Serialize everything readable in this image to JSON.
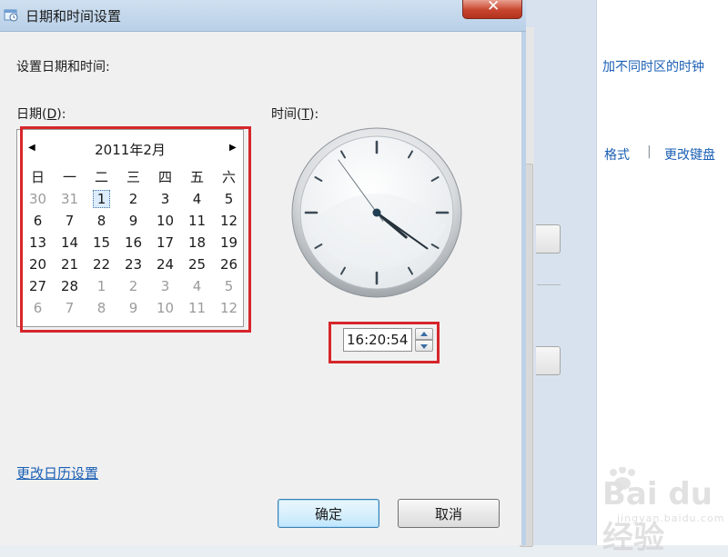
{
  "background": {
    "link_timezone_clocks": "加不同时区的时钟",
    "link_format": "格式",
    "separator": "|",
    "link_keyboard": "更改键盘"
  },
  "dialog": {
    "title": "日期和时间设置",
    "heading": "设置日期和时间:",
    "date_label_prefix": "日期(",
    "date_label_key": "D",
    "date_label_suffix": "):",
    "time_label_prefix": "时间(",
    "time_label_key": "T",
    "time_label_suffix": "):",
    "calendar": {
      "month_title": "2011年2月",
      "weekdays": [
        "日",
        "一",
        "二",
        "三",
        "四",
        "五",
        "六"
      ],
      "weeks": [
        [
          {
            "d": "30",
            "o": true
          },
          {
            "d": "31",
            "o": true
          },
          {
            "d": "1",
            "sel": true
          },
          {
            "d": "2"
          },
          {
            "d": "3"
          },
          {
            "d": "4"
          },
          {
            "d": "5"
          }
        ],
        [
          {
            "d": "6"
          },
          {
            "d": "7"
          },
          {
            "d": "8"
          },
          {
            "d": "9"
          },
          {
            "d": "10"
          },
          {
            "d": "11"
          },
          {
            "d": "12"
          }
        ],
        [
          {
            "d": "13"
          },
          {
            "d": "14"
          },
          {
            "d": "15"
          },
          {
            "d": "16"
          },
          {
            "d": "17"
          },
          {
            "d": "18"
          },
          {
            "d": "19"
          }
        ],
        [
          {
            "d": "20"
          },
          {
            "d": "21"
          },
          {
            "d": "22"
          },
          {
            "d": "23"
          },
          {
            "d": "24"
          },
          {
            "d": "25"
          },
          {
            "d": "26"
          }
        ],
        [
          {
            "d": "27"
          },
          {
            "d": "28"
          },
          {
            "d": "1",
            "o": true
          },
          {
            "d": "2",
            "o": true
          },
          {
            "d": "3",
            "o": true
          },
          {
            "d": "4",
            "o": true
          },
          {
            "d": "5",
            "o": true
          }
        ],
        [
          {
            "d": "6",
            "o": true
          },
          {
            "d": "7",
            "o": true
          },
          {
            "d": "8",
            "o": true
          },
          {
            "d": "9",
            "o": true
          },
          {
            "d": "10",
            "o": true
          },
          {
            "d": "11",
            "o": true
          },
          {
            "d": "12",
            "o": true
          }
        ]
      ]
    },
    "clock": {
      "hour": 16,
      "minute": 20,
      "second": 54
    },
    "time_value": "16:20:54",
    "link_calendar_settings": "更改日历设置",
    "ok_label": "确定",
    "cancel_label": "取消",
    "close_icon": "close-icon"
  },
  "colors": {
    "highlight_red": "#d6262b",
    "link_blue": "#1a5fb4"
  },
  "watermark": {
    "text": "Bai du 经验",
    "sub": "jingyan.baidu.com"
  }
}
